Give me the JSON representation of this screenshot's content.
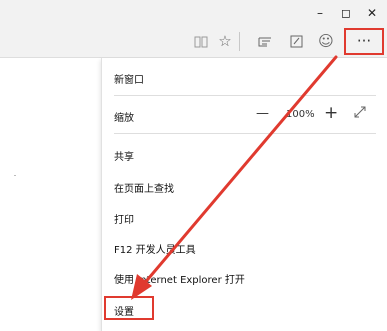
{
  "window": {
    "minimize_glyph": "–",
    "maximize_glyph": "◻",
    "close_glyph": "✕"
  },
  "toolbar": {
    "reading_view_icon": "reading-view-icon",
    "favorite_icon": "star-icon",
    "hub_icon": "hub-icon",
    "note_icon": "web-note-icon",
    "feedback_icon": "smiley-icon",
    "more_label": "···"
  },
  "menu": {
    "new_window": "新窗口",
    "zoom_label": "缩放",
    "zoom_minus": "—",
    "zoom_value": "100%",
    "zoom_plus": "+",
    "share": "共享",
    "find_on_page": "在页面上查找",
    "print": "打印",
    "f12_tools": "F12 开发人员工具",
    "open_ie": "使用 Internet Explorer 打开",
    "settings": "设置"
  },
  "annotation": {
    "arrow_color": "#e03a2f",
    "highlight_color": "#e03a2f"
  }
}
